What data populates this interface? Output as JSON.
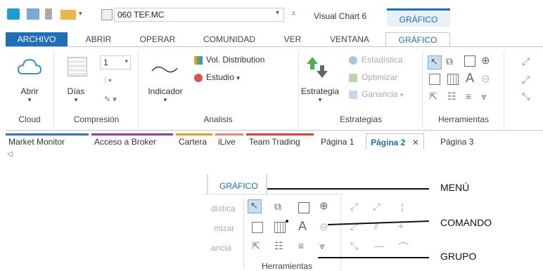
{
  "qat": {
    "symbol": "060 TEF.MC",
    "app_title": "Visual Chart 6",
    "context_tab": "GRÁFICO"
  },
  "menu_tabs": [
    "ARCHIVO",
    "ABRIR",
    "OPERAR",
    "COMUNIDAD",
    "VER",
    "VENTANA",
    "GRÁFICO"
  ],
  "ribbon": {
    "cloud": {
      "button": "Abrir",
      "group": "Cloud"
    },
    "compresion": {
      "button": "Días",
      "value": "1",
      "group": "Compresión"
    },
    "analisis": {
      "indicador": "Indicador",
      "vol": "Vol. Distribution",
      "estudio": "Estudio",
      "group": "Analisis"
    },
    "estrategias": {
      "button": "Estrategia",
      "estadistica": "Estadística",
      "optimizar": "Optimizar",
      "ganancia": "Ganancia",
      "group": "Estrategias"
    },
    "herramientas": {
      "group": "Herramientas"
    }
  },
  "doc_tabs": {
    "left": [
      "Market Monitor",
      "Acceso a Broker",
      "Cartera",
      "iLive",
      "Team Trading"
    ],
    "pages": [
      "Página 1",
      "Página 2",
      "Página 3"
    ],
    "active_page": "Página 2",
    "underline_colors": [
      "#3b6fb6",
      "#8b3fa0",
      "#e0a020",
      "#e88080",
      "#d04040"
    ]
  },
  "zoom": {
    "tab": "GRÁFICO",
    "partial_labels": [
      "dística",
      "mizar",
      "ancia"
    ],
    "group": "Herramientas"
  },
  "callouts": {
    "menu": "MENÚ",
    "comando": "COMANDO",
    "grupo": "GRUPO"
  }
}
